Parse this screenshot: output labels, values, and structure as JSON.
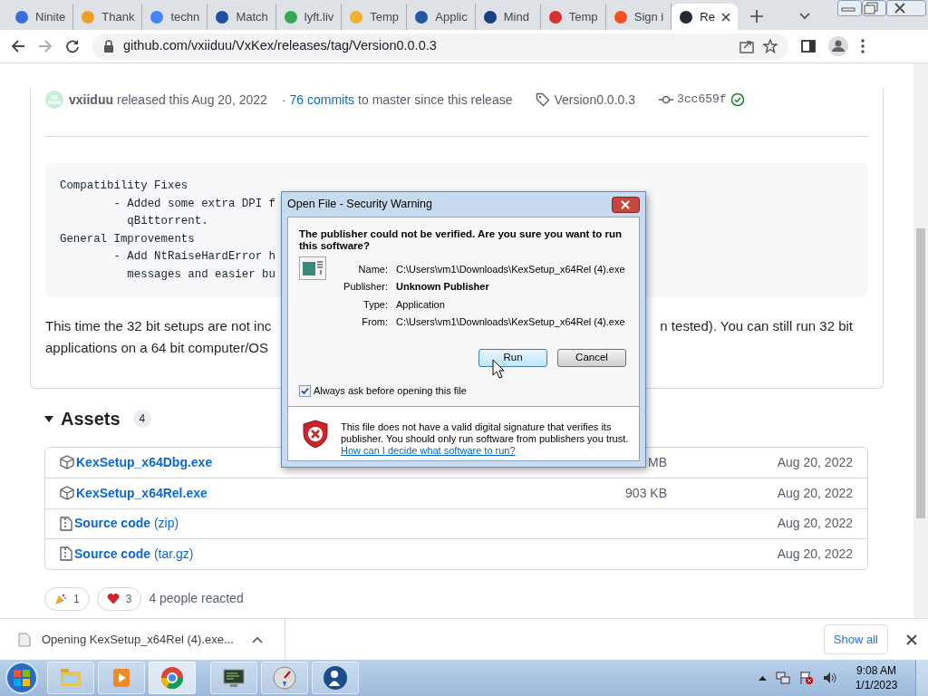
{
  "browser": {
    "tabs": [
      {
        "label": "Ninite",
        "color": "#3b6ed8",
        "selected": false
      },
      {
        "label": "Thank",
        "color": "#f0a020",
        "selected": false
      },
      {
        "label": "techn",
        "color": "#4285f4",
        "selected": false
      },
      {
        "label": "Match",
        "color": "#1e4fa0",
        "selected": false
      },
      {
        "label": "lyft.liv",
        "color": "#34a853",
        "selected": false
      },
      {
        "label": "Temp",
        "color": "#f0b030",
        "selected": false
      },
      {
        "label": "Applic",
        "color": "#2456a8",
        "selected": false
      },
      {
        "label": "Mind",
        "color": "#163f86",
        "selected": false
      },
      {
        "label": "Temp",
        "color": "#d93030",
        "selected": false
      },
      {
        "label": "Sign i",
        "color": "#f25022",
        "selected": false
      },
      {
        "label": "Re",
        "color": "#24292f",
        "selected": true
      }
    ],
    "url": "github.com/vxiiduu/VxKex/releases/tag/Version0.0.0.3"
  },
  "release": {
    "author": "vxiiduu",
    "released": "released this Aug 20, 2022",
    "separator": "·",
    "commits_link": "76 commits",
    "commits_text": "to master since this release",
    "tag": "Version0.0.0.3",
    "commit": "3cc659f",
    "verified": true
  },
  "notes_code": [
    "Compatibility Fixes",
    "        - Added some extra DPI f",
    "          qBittorrent.",
    "General Improvements",
    "        - Add NtRaiseHardError h",
    "          messages and easier bu"
  ],
  "notes_text": {
    "left": "This time the 32 bit setups are not inc",
    "right": "n tested). You can still run 32 bit",
    "line2": "applications on a 64 bit computer/OS"
  },
  "assets": {
    "title": "Assets",
    "count": "4",
    "expanded": true,
    "items": [
      {
        "kind": "package",
        "name": "KexSetup_x64Dbg.exe",
        "size": "MB",
        "date": "Aug 20, 2022"
      },
      {
        "kind": "package",
        "name": "KexSetup_x64Rel.exe",
        "size": "903 KB",
        "date": "Aug 20, 2022"
      },
      {
        "kind": "source",
        "name": "Source code",
        "suffix": "(zip)",
        "date": "Aug 20, 2022"
      },
      {
        "kind": "source",
        "name": "Source code",
        "suffix": "(tar.gz)",
        "date": "Aug 20, 2022"
      }
    ]
  },
  "reactions": {
    "items": [
      {
        "kind": "party",
        "count": "1"
      },
      {
        "kind": "heart",
        "count": "3"
      }
    ],
    "summary": "4 people reacted"
  },
  "dialog": {
    "title": "Open File - Security Warning",
    "question": "The publisher could not be verified.  Are you sure you want to run this software?",
    "fields": [
      {
        "label": "Name:",
        "value": "C:\\Users\\vm1\\Downloads\\KexSetup_x64Rel (4).exe",
        "bold": false
      },
      {
        "label": "Publisher:",
        "value": "Unknown Publisher",
        "bold": true
      },
      {
        "label": "Type:",
        "value": "Application",
        "bold": false
      },
      {
        "label": "From:",
        "value": "C:\\Users\\vm1\\Downloads\\KexSetup_x64Rel (4).exe",
        "bold": false
      }
    ],
    "buttons": [
      "Run",
      "Cancel"
    ],
    "checkbox": {
      "label": "Always ask before opening this file",
      "checked": true
    },
    "warning": "This file does not have a valid digital signature that verifies its publisher.  You should only run software from publishers you trust.",
    "link": "How can I decide what software to run?"
  },
  "download_bar": {
    "file": "Opening KexSetup_x64Rel (4).exe...",
    "show_all": "Show all"
  },
  "taskbar": {
    "time": "9:08 AM",
    "date": "1/1/2023"
  }
}
